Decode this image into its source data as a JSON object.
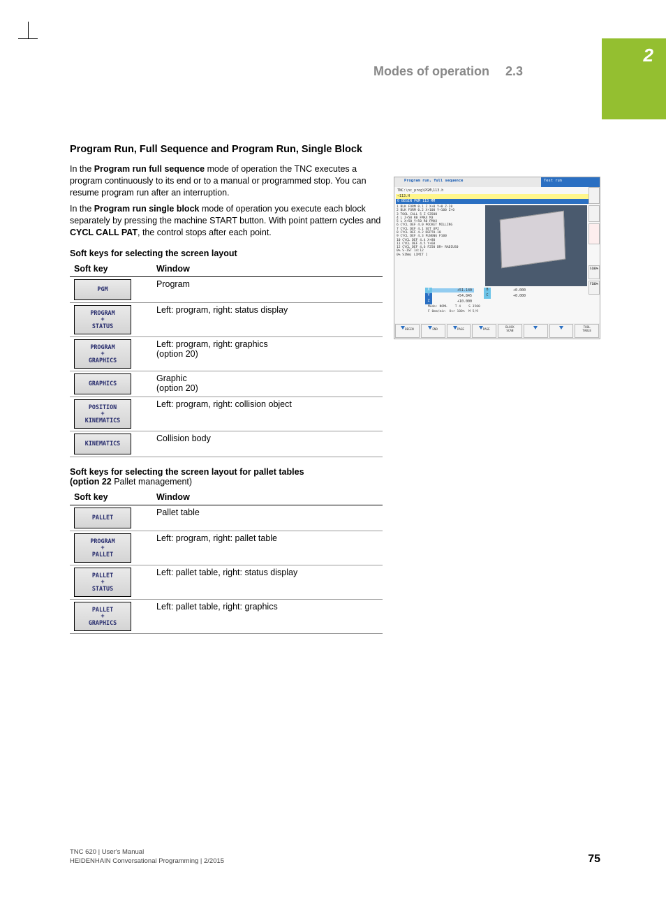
{
  "side_tab_number": "2",
  "header": {
    "title": "Modes of operation",
    "section": "2.3"
  },
  "heading": "Program Run, Full Sequence and Program Run, Single Block",
  "para1": {
    "pre": "In the ",
    "bold": "Program run full sequence",
    "post": " mode of operation the TNC executes a program continuously to its end or to a manual or programmed stop. You can resume program run after an interruption."
  },
  "para2": {
    "pre": "In the ",
    "bold1": "Program run single block",
    "mid": " mode of operation you execute each block separately by pressing the machine START button. With point pattern cycles and ",
    "bold2": "CYCL CALL PAT",
    "post": ", the control stops after each point."
  },
  "subhead1": "Soft keys for selecting the screen layout",
  "table_headers": {
    "c1": "Soft key",
    "c2": "Window"
  },
  "table1": [
    {
      "key": "PGM",
      "win": "Program",
      "tall": false
    },
    {
      "key": "PROGRAM\n+\nSTATUS",
      "win": "Left: program, right: status display",
      "tall": true
    },
    {
      "key": "PROGRAM\n+\nGRAPHICS",
      "win": "Left: program, right: graphics\n(option 20)",
      "tall": true
    },
    {
      "key": "GRAPHICS",
      "win": "Graphic\n(option 20)",
      "tall": false
    },
    {
      "key": "POSITION\n+\nKINEMATICS",
      "win": "Left: program, right: collision object",
      "tall": true
    },
    {
      "key": "KINEMATICS",
      "win": "Collision body",
      "tall": false
    }
  ],
  "subhead2_l1": "Soft keys for selecting the screen layout for pallet tables",
  "subhead2_l2a": "(option 22 ",
  "subhead2_l2b": "Pallet management)",
  "table2": [
    {
      "key": "PALLET",
      "win": "Pallet table",
      "tall": false
    },
    {
      "key": "PROGRAM\n+\nPALLET",
      "win": "Left: program, right: pallet table",
      "tall": true
    },
    {
      "key": "PALLET\n+\nSTATUS",
      "win": "Left: pallet table, right: status display",
      "tall": true
    },
    {
      "key": "PALLET\n+\nGRAPHICS",
      "win": "Left: pallet table, right: graphics",
      "tall": true
    }
  ],
  "screenshot": {
    "title_left": "Program run, full sequence",
    "title_right": "Test run",
    "path": "TNC:\\nc_prog\\PGM\\113.h",
    "yellow_bar": "→113.H",
    "blue_bar": "0  BEGIN PGM 113 MM",
    "code_lines": [
      "1  BLK FORM 0.1 Z X+0 Y+0 Z-20",
      "2  BLK FORM 0.2  X+100  Y+100  Z+0",
      "3  TOOL CALL 5 Z S3500",
      "4  L  Z+50 R0 FMAX M3",
      "5  L  X+50  Y+50 R0 FMAX",
      "6  CYCL DEF 4.0 POCKET MILLING",
      "7  CYCL DEF 4.1 SET UP2",
      "8  CYCL DEF 4.2 DEPTH-10",
      "9  CYCL DEF 4.3 PLNGNG F100",
      "10 CYCL DEF 4.4 X+80",
      "11 CYCL DEF 4.5 Y+60",
      "12 CYCL DEF 4.6 F250 DR+ RADIUS0",
      "",
      "          0% S-IST 14:12",
      "          0% SINm| LIMIT 1"
    ],
    "readout": {
      "x_val": "+51.140",
      "y_val": "+54.845",
      "z_val": "+10.000",
      "b_val": "+0.000",
      "c_val": "+0.000",
      "mode": "Mode: NOML",
      "t": "T 4",
      "s": "S 3500",
      "f": "F 0mm/min",
      "ovr": "Ovr 100%",
      "m": "M 5/9"
    },
    "side_labels": {
      "s1": "S100%",
      "s2": "F100%"
    },
    "bottom_keys": [
      "BEGIN",
      "END",
      "PAGE",
      "PAGE",
      "BLOCK\nSCAN",
      "",
      "",
      "TOOL\nTABLE"
    ]
  },
  "footer": {
    "line1": "TNC 620 | User's Manual",
    "line2": "HEIDENHAIN Conversational Programming | 2/2015",
    "page": "75"
  }
}
